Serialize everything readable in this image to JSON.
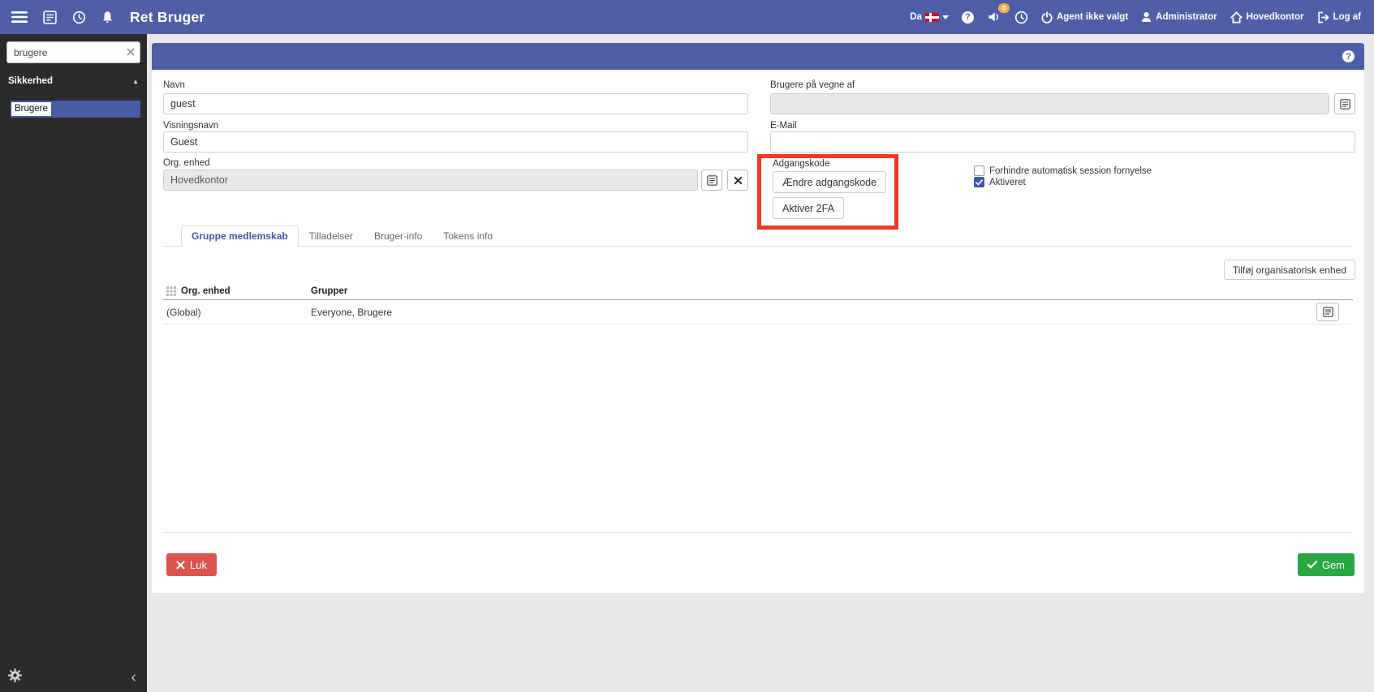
{
  "colors": {
    "accent": "#4e5fa8",
    "annotation": "#ee3b23",
    "danger": "#d9534f",
    "success": "#28a745",
    "badge": "#f0ad4e"
  },
  "icons": {
    "question": "?",
    "collapse_caret": "▲",
    "chevron_left": "‹"
  },
  "topbar": {
    "title": "Ret Bruger",
    "language_label": "Da",
    "notification_count": "0",
    "agent_label": "Agent ikke valgt",
    "user_label": "Administrator",
    "office_label": "Hovedkontor",
    "logout_label": "Log af"
  },
  "sidebar": {
    "search_value": "brugere",
    "section_label": "Sikkerhed",
    "selected_item": "Brugere"
  },
  "form": {
    "name_label": "Navn",
    "name_value": "guest",
    "display_name_label": "Visningsnavn",
    "display_name_value": "Guest",
    "org_unit_label": "Org. enhed",
    "org_unit_value": "Hovedkontor",
    "on_behalf_label": "Brugere på vegne af",
    "on_behalf_value": "",
    "email_label": "E-Mail",
    "email_value": "",
    "password_label": "Adgangskode",
    "change_password_button": "Ændre adgangskode",
    "enable_2fa_button": "Aktiver 2FA",
    "prevent_session_checkbox": "Forhindre automatisk session fornyelse",
    "activated_checkbox": "Aktiveret"
  },
  "tabs": [
    {
      "label": "Gruppe medlemskab"
    },
    {
      "label": "Tilladelser"
    },
    {
      "label": "Bruger-info"
    },
    {
      "label": "Tokens info"
    }
  ],
  "membership": {
    "add_org_button": "Tilføj organisatorisk enhed",
    "col_org": "Org. enhed",
    "col_groups": "Grupper",
    "rows": [
      {
        "org": "(Global)",
        "groups": "Everyone, Brugere"
      }
    ]
  },
  "footer": {
    "close_label": "Luk",
    "save_label": "Gem"
  }
}
